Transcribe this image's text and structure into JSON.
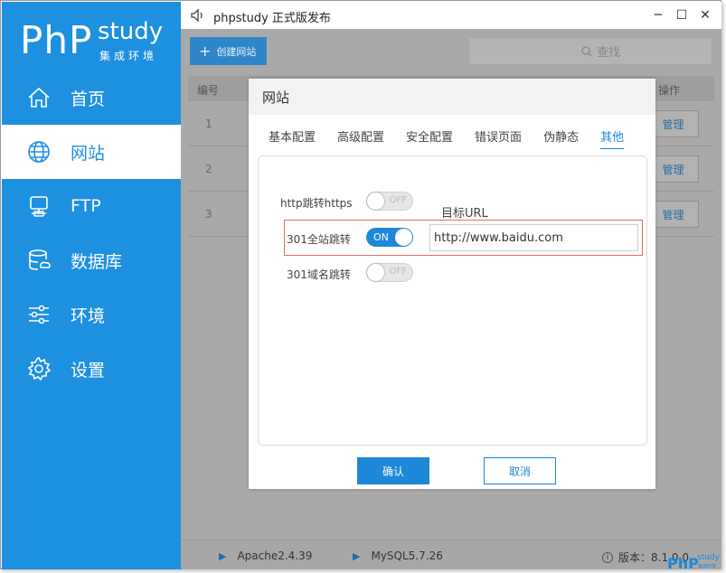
{
  "app": {
    "title": "phpstudy 正式版发布",
    "logo_php": "PhP",
    "logo_study": "study",
    "logo_sub": "集成环境"
  },
  "window_controls": {
    "minimize": "─",
    "maximize": "☐",
    "close": "✕"
  },
  "sidebar": {
    "items": [
      {
        "label": "首页",
        "icon": "home-icon",
        "active": false
      },
      {
        "label": "网站",
        "icon": "globe-icon",
        "active": true
      },
      {
        "label": "FTP",
        "icon": "server-icon",
        "active": false
      },
      {
        "label": "数据库",
        "icon": "database-icon",
        "active": false
      },
      {
        "label": "环境",
        "icon": "sliders-icon",
        "active": false
      },
      {
        "label": "设置",
        "icon": "gear-icon",
        "active": false
      }
    ]
  },
  "toolbar": {
    "create_label": "创建网站",
    "search_placeholder": "查找"
  },
  "table": {
    "headers": {
      "number": "编号",
      "action": "操作"
    },
    "rows": [
      {
        "num": "1",
        "action": "管理"
      },
      {
        "num": "2",
        "action": "管理"
      },
      {
        "num": "3",
        "action": "管理"
      }
    ]
  },
  "status": {
    "apache": "Apache2.4.39",
    "mysql": "MySQL5.7.26",
    "version_label": "版本：8.1.0.0"
  },
  "dialog": {
    "title": "网站",
    "tabs": [
      "基本配置",
      "高级配置",
      "安全配置",
      "错误页面",
      "伪静态",
      "其他"
    ],
    "active_tab": "其他",
    "settings": {
      "https_redirect": {
        "label": "http跳转https",
        "state": "OFF"
      },
      "site_redirect": {
        "label": "301全站跳转",
        "state": "ON"
      },
      "domain_redirect": {
        "label": "301域名跳转",
        "state": "OFF"
      }
    },
    "target_url_label": "目标URL",
    "target_url_value": "http://www.baidu.com",
    "confirm_label": "确认",
    "cancel_label": "取消"
  },
  "watermark": {
    "php": "PhP",
    "study": "study",
    "sub": "集成环境"
  },
  "colors": {
    "accent": "#1e88d8",
    "sidebar": "#1e90e0",
    "overlay_gray": "#a9a9a9",
    "highlight_box": "#e46a6a"
  }
}
